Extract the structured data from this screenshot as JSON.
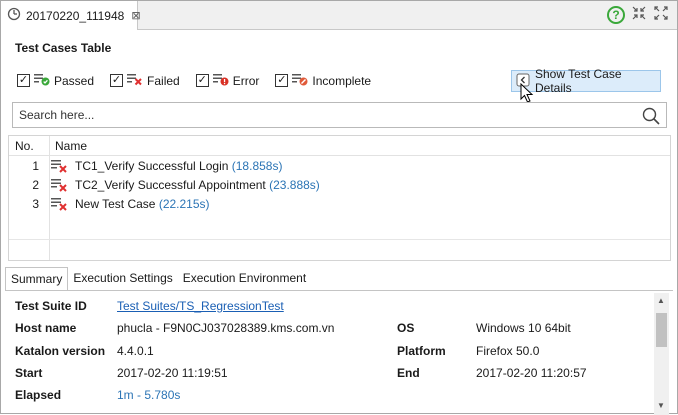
{
  "editor_tab": {
    "title": "20170220_111948",
    "close_glyph": "⊠"
  },
  "section_title": "Test Cases Table",
  "filters": [
    {
      "label": "Passed",
      "checked": true,
      "icon": "passed-icon"
    },
    {
      "label": "Failed",
      "checked": true,
      "icon": "failed-icon"
    },
    {
      "label": "Error",
      "checked": true,
      "icon": "error-icon"
    },
    {
      "label": "Incomplete",
      "checked": true,
      "icon": "incomplete-icon"
    }
  ],
  "details_button": {
    "label": "Show Test Case Details"
  },
  "search": {
    "placeholder": "Search here..."
  },
  "table": {
    "headers": {
      "no": "No.",
      "name": "Name"
    },
    "rows": [
      {
        "no": "1",
        "name": "TC1_Verify Successful Login",
        "duration": "(18.858s)",
        "status": "failed"
      },
      {
        "no": "2",
        "name": "TC2_Verify Successful Appointment",
        "duration": "(23.888s)",
        "status": "failed"
      },
      {
        "no": "3",
        "name": "New Test Case",
        "duration": "(22.215s)",
        "status": "failed"
      }
    ]
  },
  "bottom_tabs": [
    "Summary",
    "Execution Settings",
    "Execution Environment"
  ],
  "summary": {
    "test_suite_id_label": "Test Suite ID",
    "test_suite_id": "Test Suites/TS_RegressionTest",
    "host_name_label": "Host name",
    "host_name": "phucla - F9N0CJ037028389.kms.com.vn",
    "os_label": "OS",
    "os": "Windows 10 64bit",
    "katalon_version_label": "Katalon version",
    "katalon_version": "4.4.0.1",
    "platform_label": "Platform",
    "platform": "Firefox 50.0",
    "start_label": "Start",
    "start": "2017-02-20 11:19:51",
    "end_label": "End",
    "end": "2017-02-20 11:20:57",
    "elapsed_label": "Elapsed",
    "elapsed": "1m - 5.780s"
  },
  "colors": {
    "accent": "#2b74b5",
    "link": "#1a5fb4",
    "failed": "#e03030",
    "passed": "#3aa83a",
    "button_bg": "#dcecfa"
  }
}
